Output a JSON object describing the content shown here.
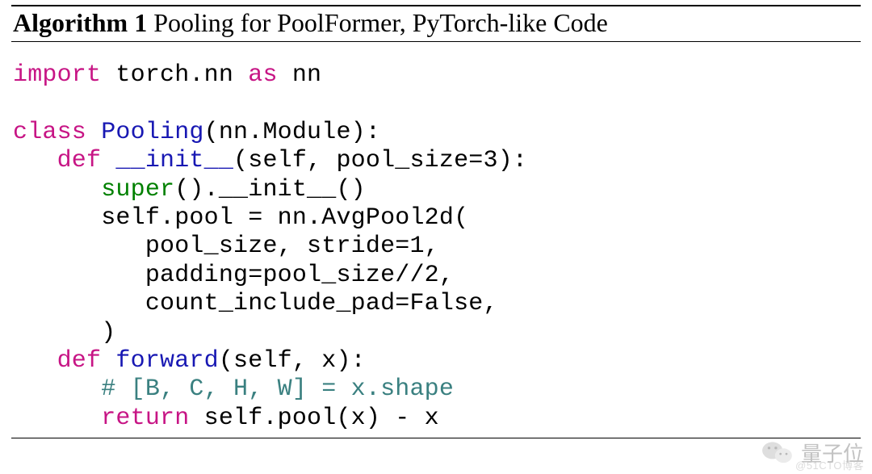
{
  "title": {
    "label": "Algorithm 1",
    "caption": "Pooling for PoolFormer, PyTorch-like Code"
  },
  "code": {
    "l1_import": "import",
    "l1_rest": " torch.nn ",
    "l1_as": "as",
    "l1_nn": " nn",
    "blank1": "",
    "l3_class": "class",
    "l3_name": " Pooling",
    "l3_rest": "(nn.Module):",
    "l4_indent": "   ",
    "l4_def": "def",
    "l4_name": " __init__",
    "l4_sig": "(self, pool_size=3):",
    "l5_indent": "      ",
    "l5_super": "super",
    "l5_rest": "().__init__()",
    "l6_indent": "      ",
    "l6_self": "self",
    "l6_rest": ".pool = nn.AvgPool2d(",
    "l7": "         pool_size, stride=1,",
    "l8": "         padding=pool_size//2,",
    "l9": "         count_include_pad=False,",
    "l10": "      )",
    "l11_indent": "   ",
    "l11_def": "def",
    "l11_name": " forward",
    "l11_sig": "(self, x):",
    "l12_indent": "      ",
    "l12_cmt": "# [B, C, H, W] = x.shape",
    "l13_indent": "      ",
    "l13_return": "return",
    "l13_rest": " self.pool(x) - x"
  },
  "watermark": {
    "main": "量子位",
    "sub": "@51CTO博客"
  }
}
